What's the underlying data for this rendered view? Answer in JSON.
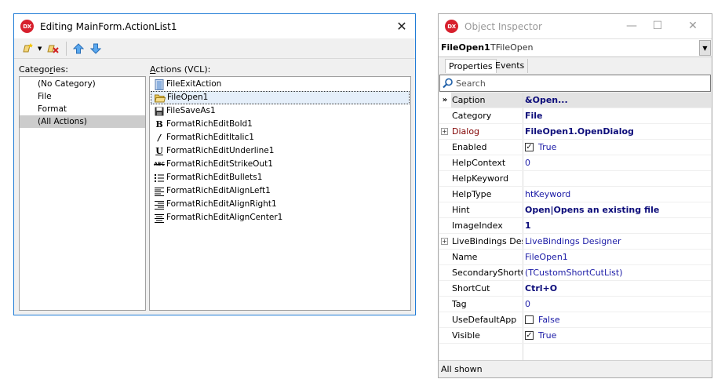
{
  "editor": {
    "title": "Editing MainForm.ActionList1",
    "categories_label_pre": "Catego",
    "categories_label_ul": "r",
    "categories_label_post": "ies:",
    "actions_label_ul": "A",
    "actions_label_post": "ctions (VCL):",
    "categories": [
      "(No Category)",
      "File",
      "Format",
      "(All Actions)"
    ],
    "selected_category": "(All Actions)",
    "actions": [
      {
        "label": "FileExitAction",
        "icon": "door-exit-icon"
      },
      {
        "label": "FileOpen1",
        "icon": "folder-open-icon"
      },
      {
        "label": "FileSaveAs1",
        "icon": "floppy-disk-icon"
      },
      {
        "label": "FormatRichEditBold1",
        "icon": "bold-icon"
      },
      {
        "label": "FormatRichEditItalic1",
        "icon": "italic-icon"
      },
      {
        "label": "FormatRichEditUnderline1",
        "icon": "underline-icon"
      },
      {
        "label": "FormatRichEditStrikeOut1",
        "icon": "strikeout-icon"
      },
      {
        "label": "FormatRichEditBullets1",
        "icon": "bullets-icon"
      },
      {
        "label": "FormatRichEditAlignLeft1",
        "icon": "align-left-icon"
      },
      {
        "label": "FormatRichEditAlignRight1",
        "icon": "align-right-icon"
      },
      {
        "label": "FormatRichEditAlignCenter1",
        "icon": "align-center-icon"
      }
    ],
    "selected_action": "FileOpen1",
    "toolbar": [
      "new-action-icon",
      "dropdown-arrow-icon",
      "delete-action-icon",
      "move-up-icon",
      "move-down-icon"
    ]
  },
  "inspector": {
    "title": "Object Inspector",
    "component_name": "FileOpen1",
    "component_type": "TFileOpen",
    "tabs": [
      "Properties",
      "Events"
    ],
    "active_tab": "Properties",
    "search_placeholder": "Search",
    "properties": [
      {
        "name": "Caption",
        "value": "&Open...",
        "style": "bold",
        "selected": true
      },
      {
        "name": "Category",
        "value": "File",
        "style": "bold"
      },
      {
        "name": "Dialog",
        "value": "FileOpen1.OpenDialog",
        "style": "bold",
        "name_style": "red",
        "expandable": true
      },
      {
        "name": "Enabled",
        "value": "True",
        "style": "blue",
        "checkbox": true,
        "checked": true
      },
      {
        "name": "HelpContext",
        "value": "0",
        "style": "blue"
      },
      {
        "name": "HelpKeyword",
        "value": "",
        "style": "blue"
      },
      {
        "name": "HelpType",
        "value": "htKeyword",
        "style": "blue"
      },
      {
        "name": "Hint",
        "value": "Open|Opens an existing file",
        "style": "bold"
      },
      {
        "name": "ImageIndex",
        "value": "1",
        "style": "bold"
      },
      {
        "name": "LiveBindings Designer",
        "value": "LiveBindings Designer",
        "style": "blue",
        "expandable": true
      },
      {
        "name": "Name",
        "value": "FileOpen1",
        "style": "blue"
      },
      {
        "name": "SecondaryShortCuts",
        "value": "(TCustomShortCutList)",
        "style": "blue"
      },
      {
        "name": "ShortCut",
        "value": "Ctrl+O",
        "style": "bold"
      },
      {
        "name": "Tag",
        "value": "0",
        "style": "blue"
      },
      {
        "name": "UseDefaultApp",
        "value": "False",
        "style": "blue",
        "checkbox": true,
        "checked": false
      },
      {
        "name": "Visible",
        "value": "True",
        "style": "blue",
        "checkbox": true,
        "checked": true
      }
    ],
    "status": "All shown"
  },
  "colors": {
    "accent_border": "#1f7bd6",
    "badge": "#d7202d",
    "value_blue": "#1a1aa6",
    "value_bold": "#0c0c7a",
    "name_red": "#800000"
  }
}
